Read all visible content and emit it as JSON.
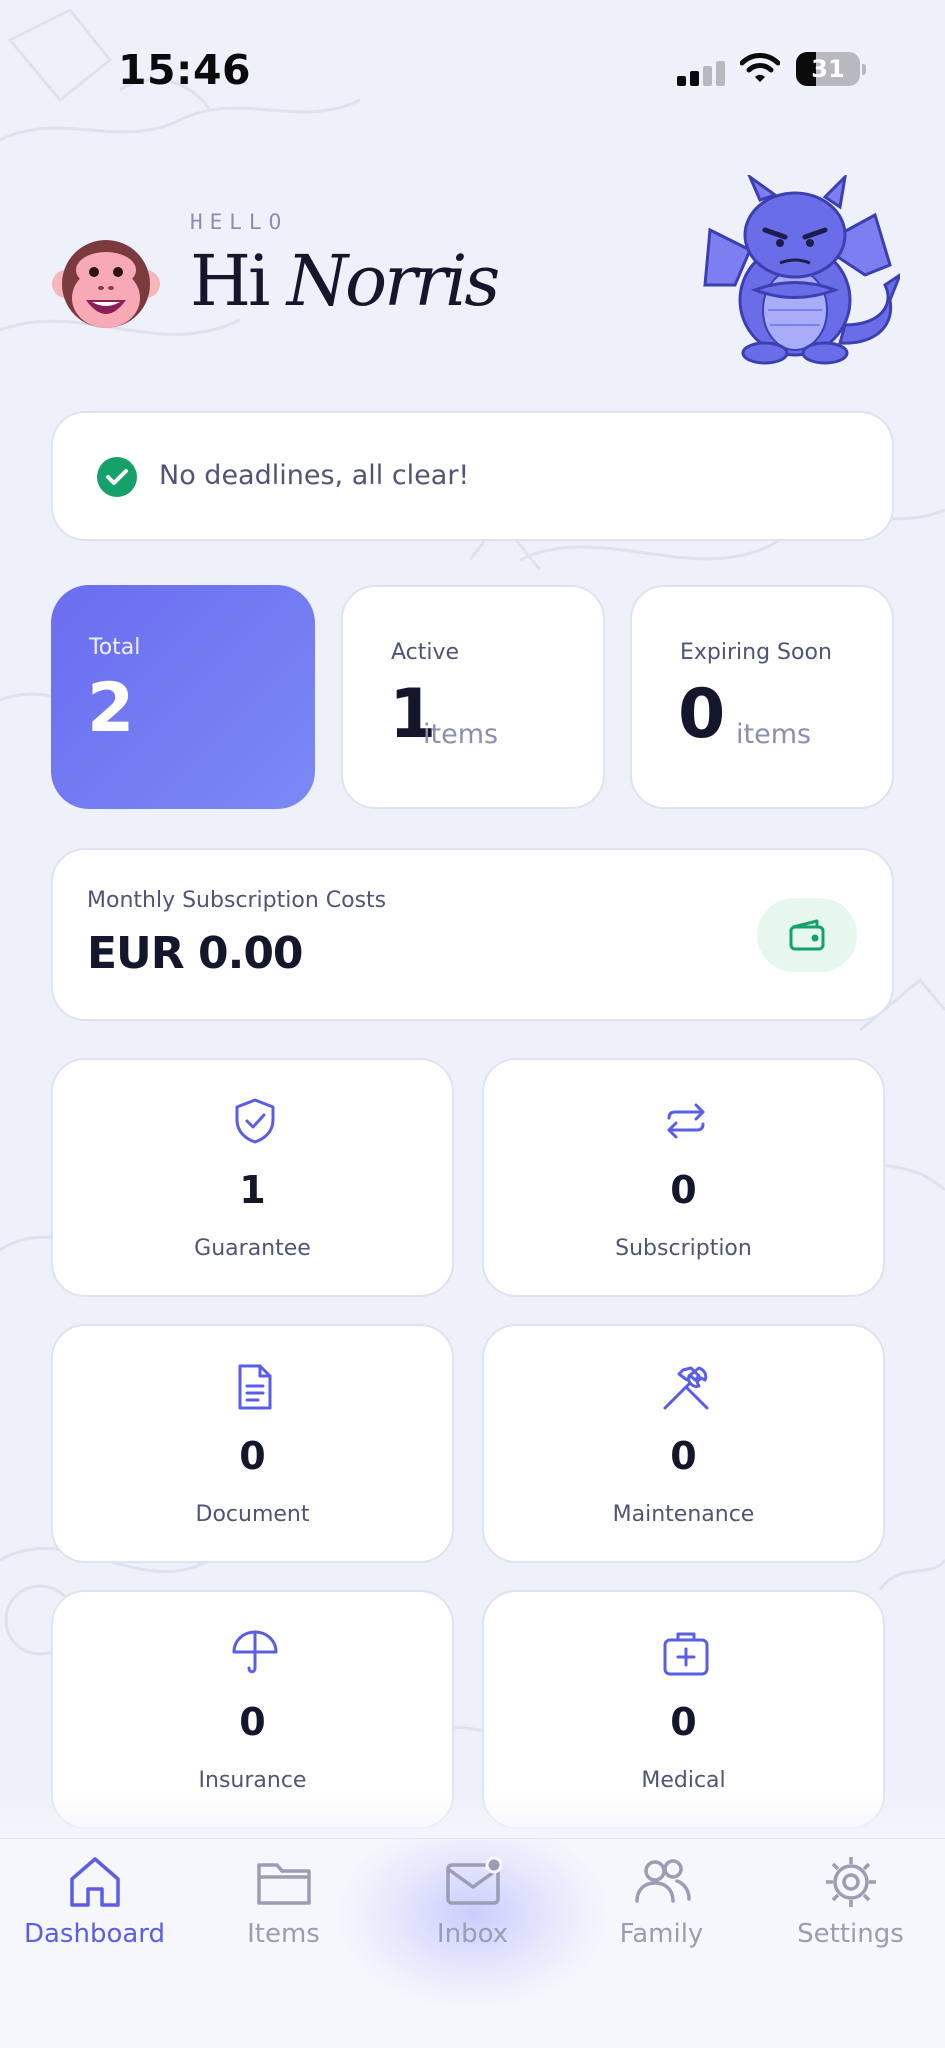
{
  "status_bar": {
    "time": "15:46",
    "battery": "31",
    "battery_level": 0.31
  },
  "header": {
    "eyebrow": "HELLO",
    "greeting_word": "Hi",
    "user_name": "Norris",
    "avatar_icon": "monkey-face-icon",
    "mascot_icon": "dragon-mascot-icon"
  },
  "deadline": {
    "text": "No deadlines, all clear!",
    "icon": "check-circle-icon"
  },
  "stats": {
    "total": {
      "label": "Total",
      "value": "2"
    },
    "active": {
      "label": "Active",
      "value": "1",
      "unit": "items"
    },
    "expiring": {
      "label": "Expiring Soon",
      "value": "0",
      "unit": "items"
    }
  },
  "subscription_costs": {
    "label": "Monthly Subscription Costs",
    "value": "EUR 0.00",
    "icon": "wallet-icon"
  },
  "categories": [
    {
      "label": "Guarantee",
      "count": "1",
      "icon": "shield-check-icon"
    },
    {
      "label": "Subscription",
      "count": "0",
      "icon": "repeat-icon"
    },
    {
      "label": "Document",
      "count": "0",
      "icon": "document-icon"
    },
    {
      "label": "Maintenance",
      "count": "0",
      "icon": "tools-icon"
    },
    {
      "label": "Insurance",
      "count": "0",
      "icon": "umbrella-icon"
    },
    {
      "label": "Medical",
      "count": "0",
      "icon": "medical-kit-icon"
    }
  ],
  "nav": [
    {
      "label": "Dashboard",
      "icon": "home-icon",
      "active": true
    },
    {
      "label": "Items",
      "icon": "folder-icon",
      "active": false
    },
    {
      "label": "Inbox",
      "icon": "mail-icon",
      "active": false
    },
    {
      "label": "Family",
      "icon": "users-icon",
      "active": false
    },
    {
      "label": "Settings",
      "icon": "gear-icon",
      "active": false
    }
  ],
  "colors": {
    "accent": "#6366f1",
    "accent_light": "#7b89f4",
    "success": "#16a06a",
    "background": "#eef0fa",
    "card": "#ffffff",
    "text": "#14172b",
    "muted": "#4f5575",
    "nav_inactive": "#9a9db3"
  }
}
